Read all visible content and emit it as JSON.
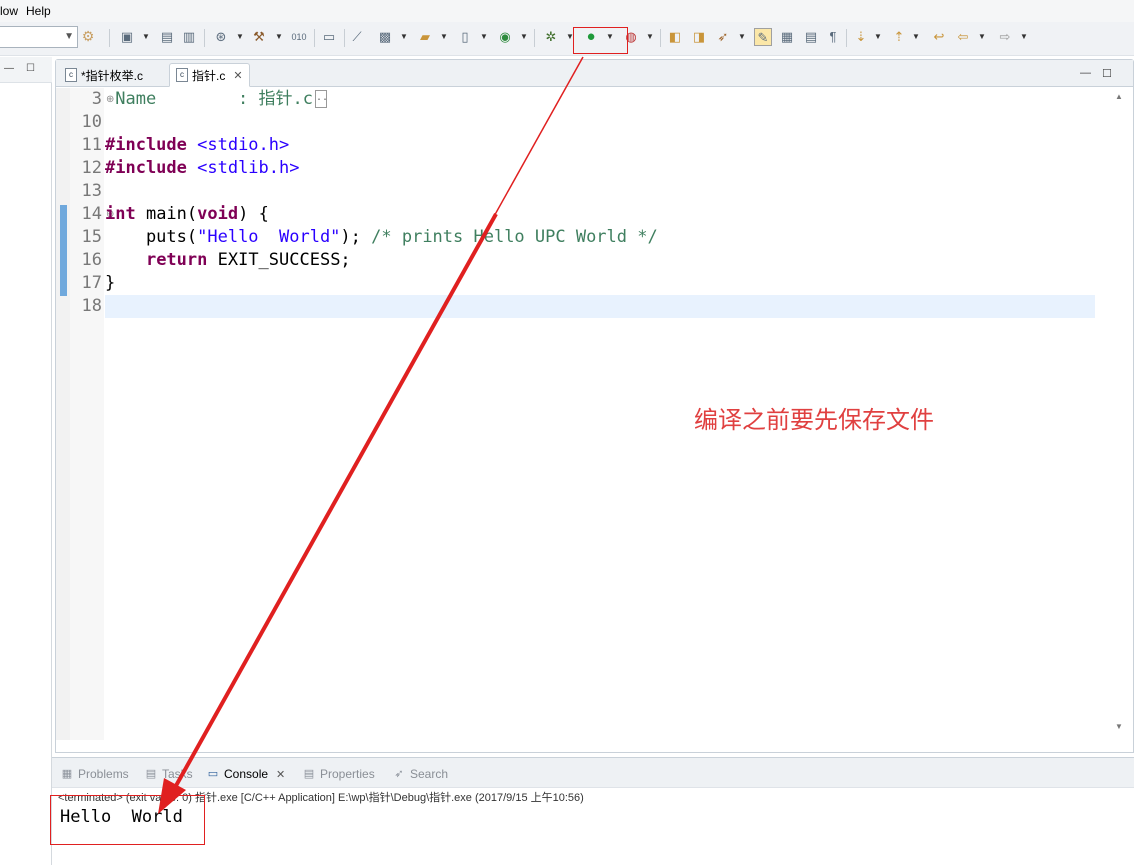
{
  "menu": {
    "items": [
      "low",
      "Help"
    ]
  },
  "editor": {
    "tabs": [
      {
        "label": "*指针枚举.c",
        "active": false
      },
      {
        "label": "指针.c",
        "active": true
      }
    ],
    "lines": [
      {
        "num": "3",
        "folded": true,
        "tokens": [
          {
            "t": " Name        : 指针.c",
            "c": "name-c"
          }
        ]
      },
      {
        "num": "10",
        "tokens": []
      },
      {
        "num": "11",
        "tokens": [
          {
            "t": "#include ",
            "c": "kw"
          },
          {
            "t": "<stdio.h>",
            "c": "inc"
          }
        ]
      },
      {
        "num": "12",
        "tokens": [
          {
            "t": "#include ",
            "c": "kw"
          },
          {
            "t": "<stdlib.h>",
            "c": "inc"
          }
        ]
      },
      {
        "num": "13",
        "tokens": []
      },
      {
        "num": "14",
        "tokens": [
          {
            "t": "int",
            "c": "kw"
          },
          {
            "t": " main(",
            "c": ""
          },
          {
            "t": "void",
            "c": "kw"
          },
          {
            "t": ") {",
            "c": ""
          }
        ]
      },
      {
        "num": "15",
        "tokens": [
          {
            "t": "    puts(",
            "c": ""
          },
          {
            "t": "\"Hello  World\"",
            "c": "str"
          },
          {
            "t": "); ",
            "c": ""
          },
          {
            "t": "/* prints Hello UPC World */",
            "c": "cmt"
          }
        ]
      },
      {
        "num": "16",
        "tokens": [
          {
            "t": "    ",
            "c": ""
          },
          {
            "t": "return",
            "c": "kw"
          },
          {
            "t": " EXIT_SUCCESS;",
            "c": ""
          }
        ]
      },
      {
        "num": "17",
        "tokens": [
          {
            "t": "}",
            "c": ""
          }
        ]
      },
      {
        "num": "18",
        "tokens": []
      }
    ]
  },
  "annotation": {
    "text": "编译之前要先保存文件",
    "color": "#e04040"
  },
  "panel": {
    "tabs": [
      {
        "label": "Problems",
        "icon": "problems-icon",
        "active": false
      },
      {
        "label": "Tasks",
        "icon": "tasks-icon",
        "active": false
      },
      {
        "label": "Console",
        "icon": "console-icon",
        "active": true
      },
      {
        "label": "Properties",
        "icon": "properties-icon",
        "active": false
      },
      {
        "label": "Search",
        "icon": "search-icon",
        "active": false
      }
    ],
    "status": "<terminated> (exit value: 0) 指针.exe [C/C++ Application] E:\\wp\\指针\\Debug\\指针.exe (2017/9/15 上午10:56)",
    "output": "Hello  World"
  }
}
